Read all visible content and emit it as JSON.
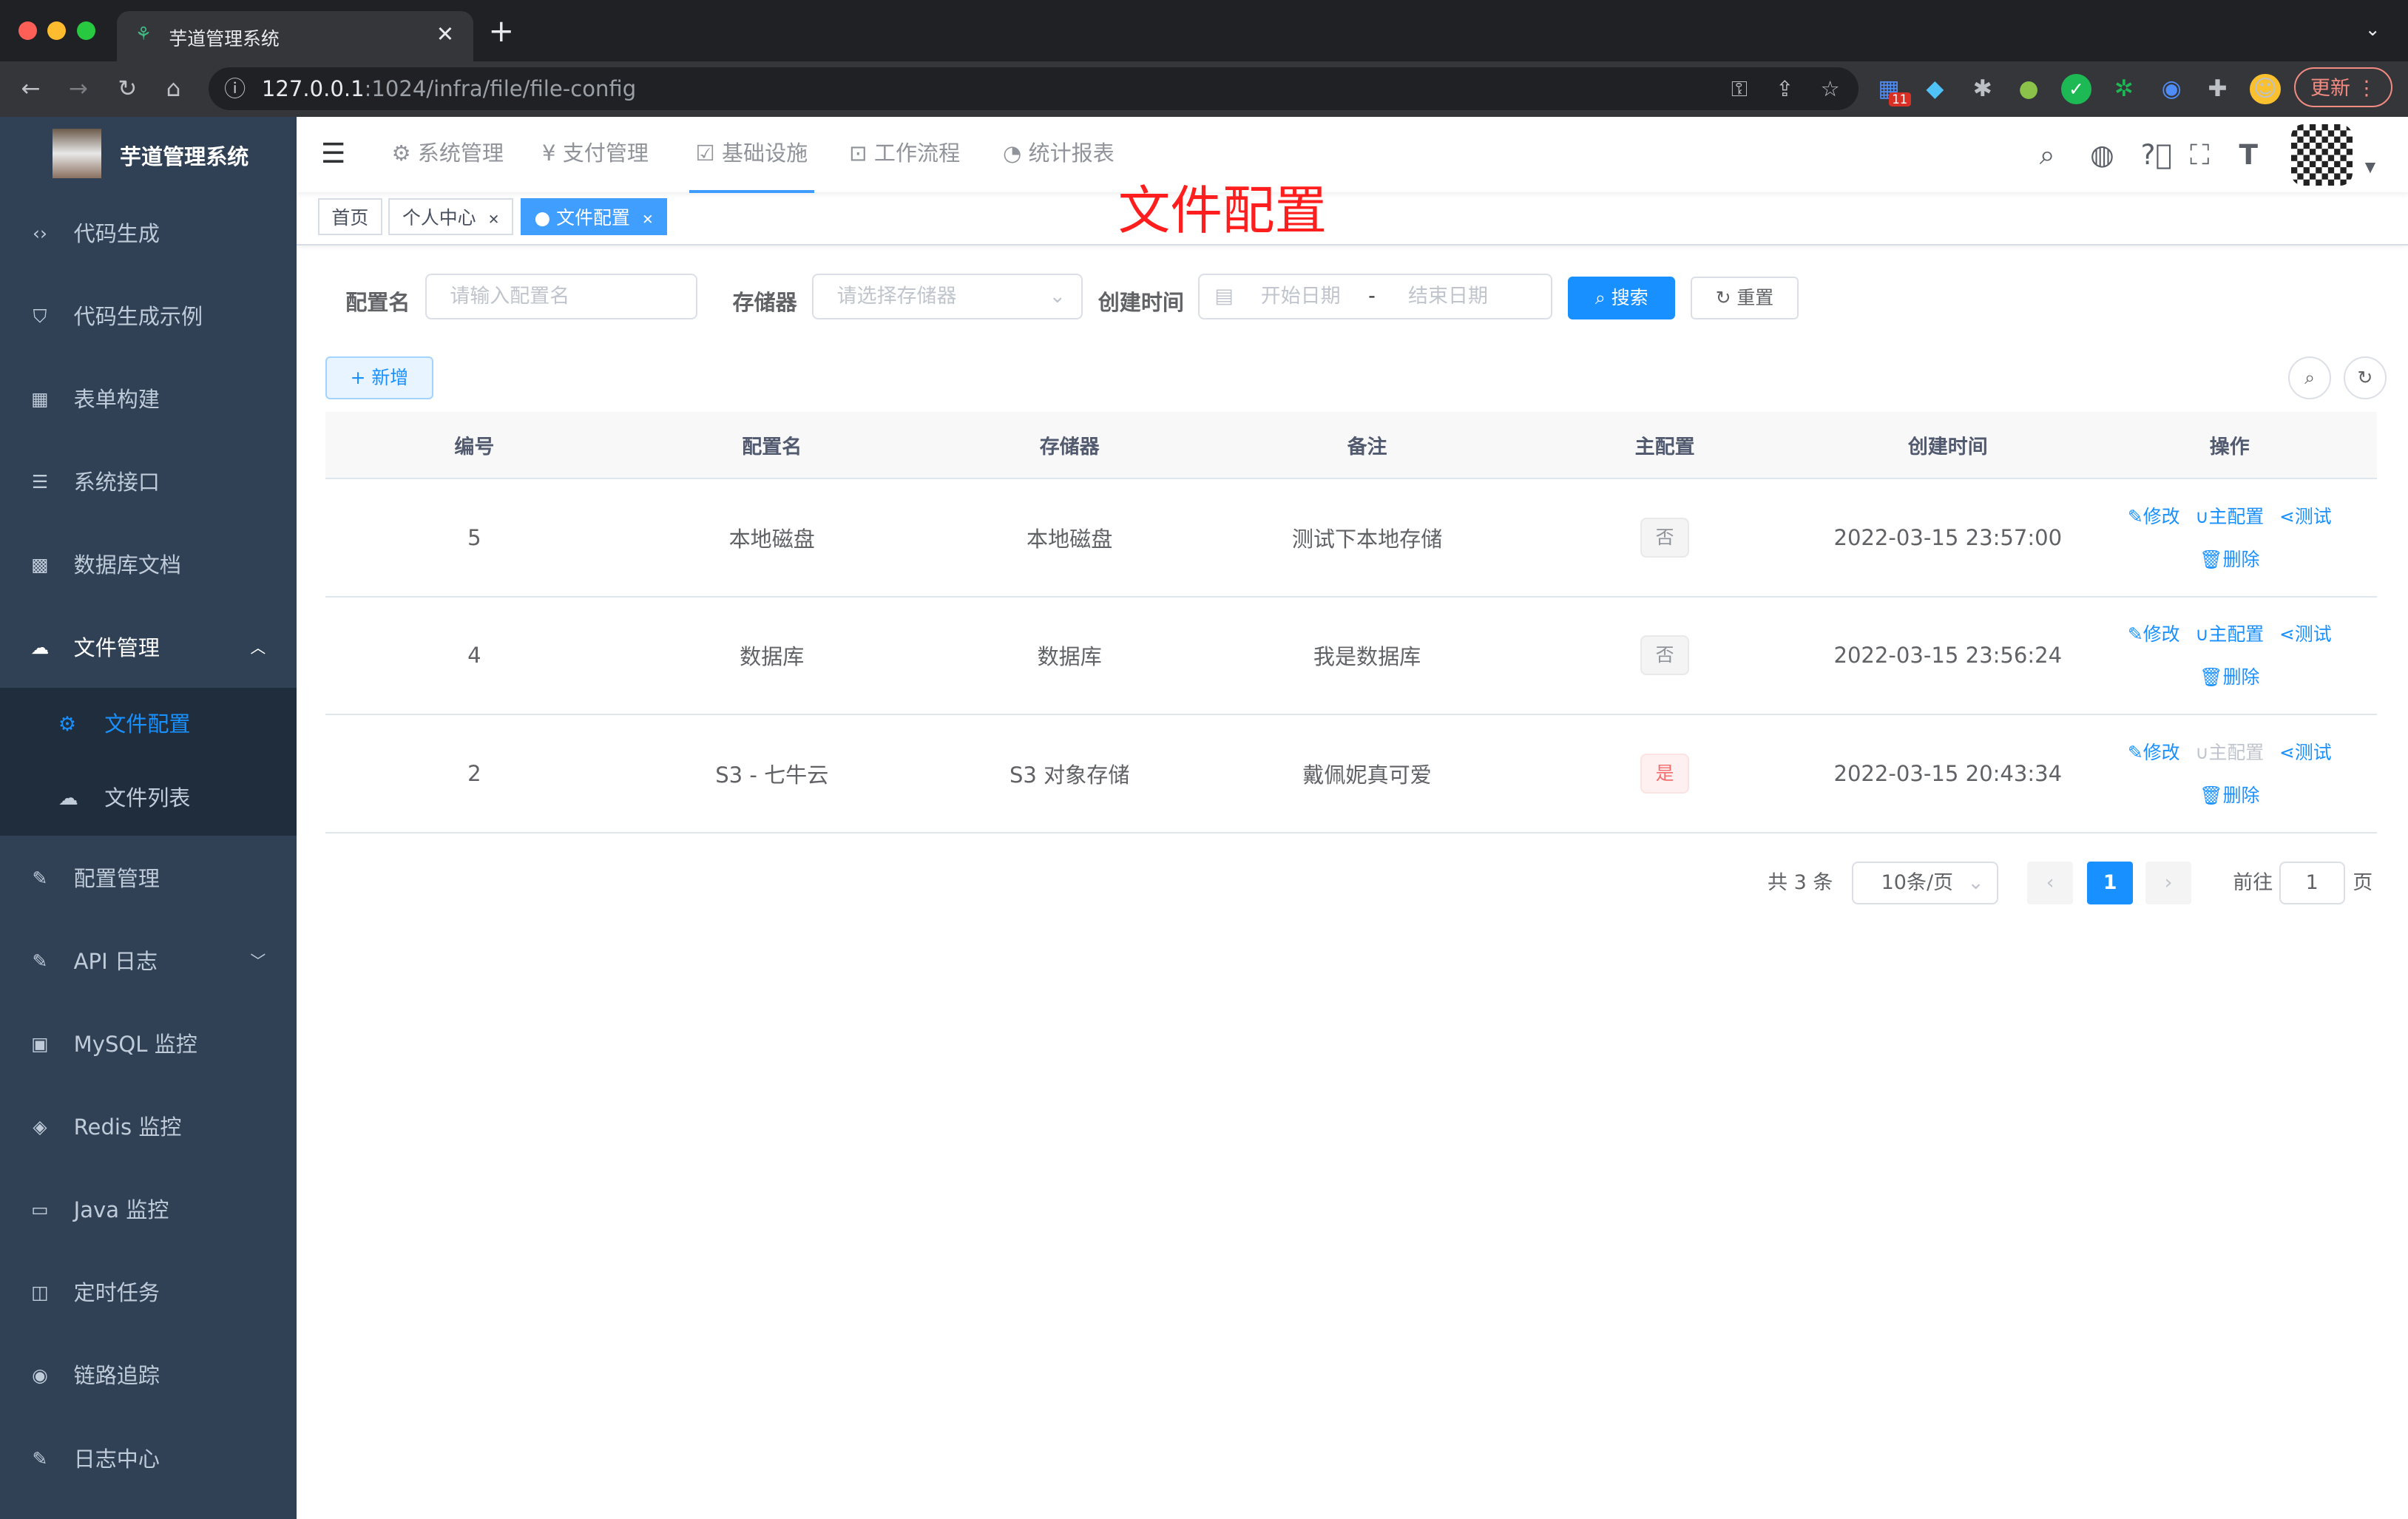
{
  "browser": {
    "tab_title": "芋道管理系统",
    "url_host": "127.0.0.1",
    "url_rest": ":1024/infra/file/file-config",
    "update_label": "更新",
    "ext_badge": "11"
  },
  "sidebar": {
    "title": "芋道管理系统",
    "items": [
      {
        "label": "代码生成",
        "icon": "code-icon"
      },
      {
        "label": "代码生成示例",
        "icon": "shield-icon"
      },
      {
        "label": "表单构建",
        "icon": "table-icon"
      },
      {
        "label": "系统接口",
        "icon": "sliders-icon"
      },
      {
        "label": "数据库文档",
        "icon": "grid-icon"
      },
      {
        "label": "文件管理",
        "icon": "cloud-icon",
        "expanded": true
      },
      {
        "label": "配置管理",
        "icon": "edit-icon"
      },
      {
        "label": "API 日志",
        "icon": "log-icon"
      },
      {
        "label": "MySQL 监控",
        "icon": "monitor-icon"
      },
      {
        "label": "Redis 监控",
        "icon": "redis-icon"
      },
      {
        "label": "Java 监控",
        "icon": "screen-icon"
      },
      {
        "label": "定时任务",
        "icon": "job-icon"
      },
      {
        "label": "链路追踪",
        "icon": "eye-icon"
      },
      {
        "label": "日志中心",
        "icon": "edit-icon"
      }
    ],
    "sub_items": [
      {
        "label": "文件配置",
        "active": true
      },
      {
        "label": "文件列表"
      }
    ]
  },
  "topnav": {
    "menus": [
      {
        "label": "系统管理"
      },
      {
        "label": "支付管理"
      },
      {
        "label": "基础设施",
        "active": true
      },
      {
        "label": "工作流程"
      },
      {
        "label": "统计报表"
      }
    ]
  },
  "tags": [
    {
      "label": "首页"
    },
    {
      "label": "个人中心"
    },
    {
      "label": "文件配置",
      "active": true
    }
  ],
  "page_title": "文件配置",
  "search": {
    "name_label": "配置名",
    "name_placeholder": "请输入配置名",
    "storage_label": "存储器",
    "storage_placeholder": "请选择存储器",
    "time_label": "创建时间",
    "start_placeholder": "开始日期",
    "sep": "-",
    "end_placeholder": "结束日期",
    "search_btn": "搜索",
    "reset_btn": "重置"
  },
  "add_btn": "新增",
  "table": {
    "columns": [
      "编号",
      "配置名",
      "存储器",
      "备注",
      "主配置",
      "创建时间",
      "操作"
    ],
    "rows": [
      {
        "id": "5",
        "name": "本地磁盘",
        "storage": "本地磁盘",
        "remark": "测试下本地存储",
        "master": "否",
        "created": "2022-03-15 23:57:00"
      },
      {
        "id": "4",
        "name": "数据库",
        "storage": "数据库",
        "remark": "我是数据库",
        "master": "否",
        "created": "2022-03-15 23:56:24"
      },
      {
        "id": "2",
        "name": "S3 - 七牛云",
        "storage": "S3 对象存储",
        "remark": "戴佩妮真可爱",
        "master": "是",
        "created": "2022-03-15 20:43:34"
      }
    ],
    "actions": {
      "edit": "修改",
      "master": "主配置",
      "test": "测试",
      "delete": "删除"
    }
  },
  "pagination": {
    "total": "共 3 条",
    "page_size": "10条/页",
    "current": "1",
    "goto": "前往",
    "goto_value": "1",
    "page_unit": "页"
  },
  "colors": {
    "primary": "#1890ff",
    "sidebar_bg": "#304156",
    "title_red": "#ff1e1e"
  }
}
